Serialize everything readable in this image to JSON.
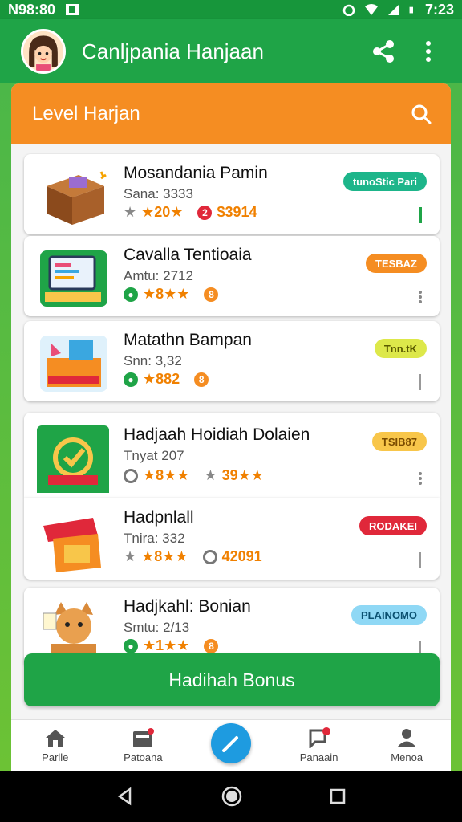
{
  "status": {
    "left_text": "N98:80",
    "time": "7:23"
  },
  "app_bar": {
    "title": "Canljpania Hanjaan",
    "avatar": "girl-avatar",
    "share_icon": "share-icon",
    "menu_icon": "more-vert-icon"
  },
  "level": {
    "title": "Level Harjan",
    "search_icon": "search-icon"
  },
  "items": [
    {
      "title": "Mosandania Pamin",
      "subtitle": "Sana: 3333",
      "meta_a": "★20★",
      "meta_b": "$3914",
      "badge": "tunoStic Pari",
      "badge_color": "#1db58a",
      "badge_text_color": "#ffffff",
      "thumb": "box-icon"
    },
    {
      "title": "Cavalla Tentioaia",
      "subtitle": "Amtu: 2712",
      "meta_a": "★8★★",
      "meta_b": "",
      "badge": "TESBAZ",
      "badge_color": "#f58d22",
      "badge_text_color": "#ffffff",
      "thumb": "laptop-icon"
    },
    {
      "title": "Matathn Bampan",
      "subtitle": "Snn: 3,32",
      "meta_a": "★882",
      "meta_b": "",
      "badge": "Tnn.tK",
      "badge_color": "#dde84a",
      "badge_text_color": "#5a5a00",
      "thumb": "gift-box-icon"
    },
    {
      "title": "Hadjaah Hoidiah Dolaien",
      "subtitle": "Tnyat 207",
      "meta_a": "★8★★",
      "meta_b": "39★★",
      "badge": "TSIB87",
      "badge_color": "#f8c64a",
      "badge_text_color": "#7a4b00",
      "thumb": "coins-icon"
    },
    {
      "title": "Hadpnlall",
      "subtitle": "Tnira: 332",
      "meta_a": "★8★★",
      "meta_b": "42091",
      "badge": "RODAKEI",
      "badge_color": "#e0283a",
      "badge_text_color": "#ffffff",
      "thumb": "sale-box-icon"
    },
    {
      "title": "Hadjkahl: Bonian",
      "subtitle": "Smtu: 2/13",
      "meta_a": "★1★★",
      "meta_b": "",
      "badge": "PLAINOMO",
      "badge_color": "#8fd8f5",
      "badge_text_color": "#0a5070",
      "thumb": "fox-icon"
    }
  ],
  "bonus_button": {
    "label": "Hadihah Bonus"
  },
  "nav": [
    {
      "label": "Parlle",
      "icon": "home-icon"
    },
    {
      "label": "Patoana",
      "icon": "archive-icon"
    },
    {
      "label": "",
      "icon": "pencil-icon"
    },
    {
      "label": "Panaain",
      "icon": "chat-icon"
    },
    {
      "label": "Menoa",
      "icon": "person-icon"
    }
  ]
}
